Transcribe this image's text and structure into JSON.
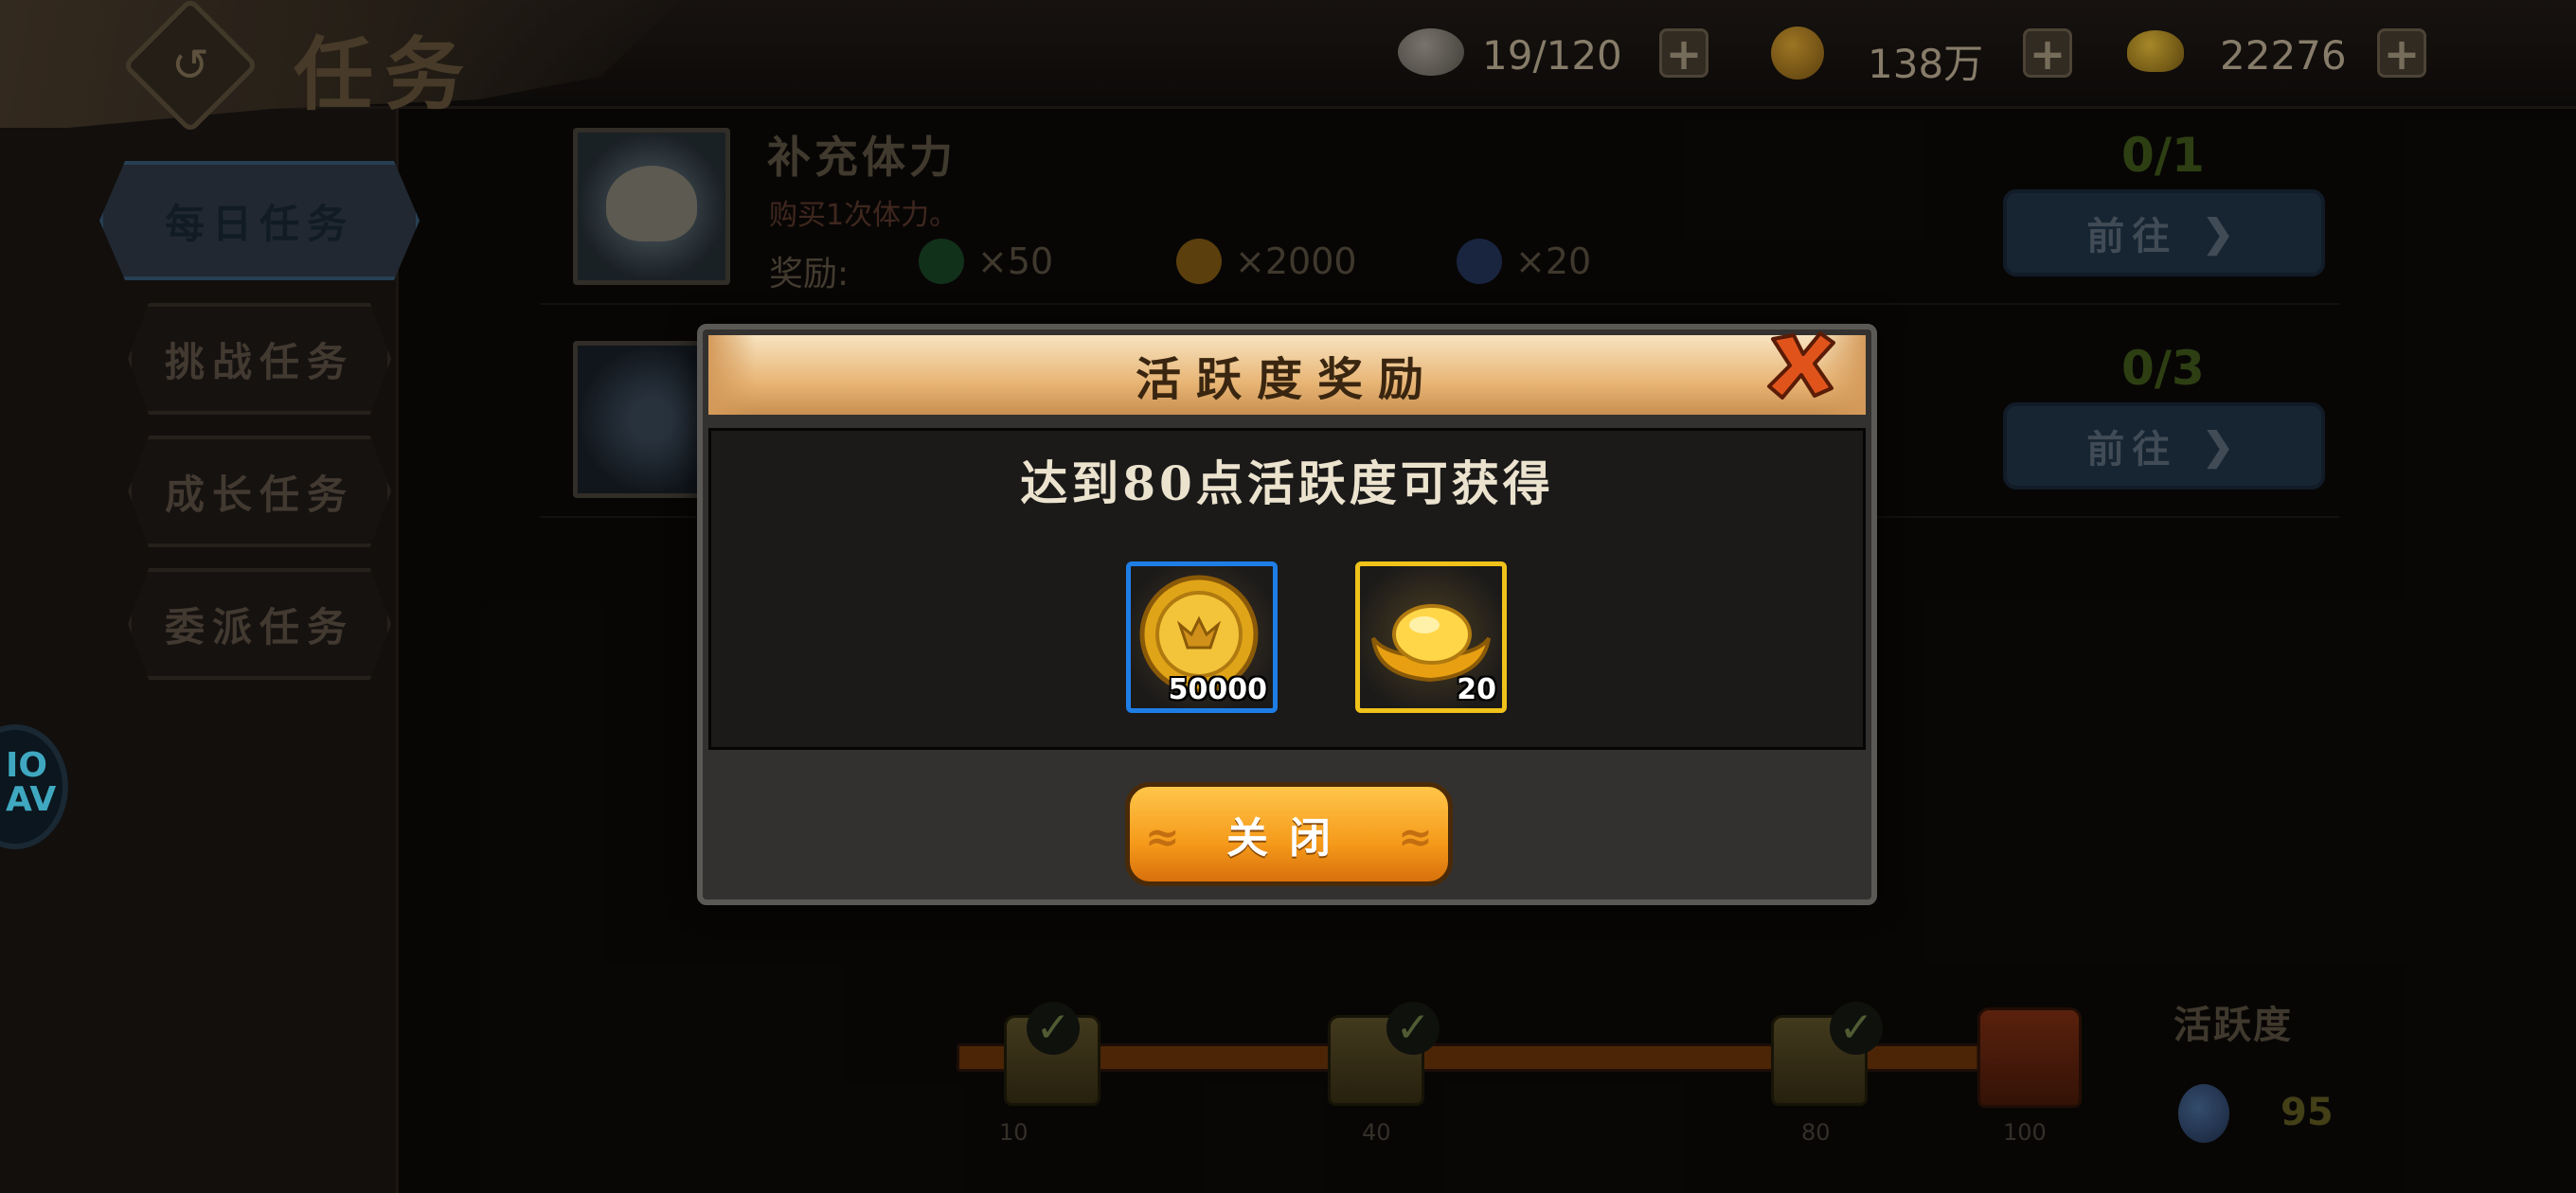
{
  "header": {
    "title": "任务",
    "back_icon": "back-arrow-icon",
    "resources": [
      {
        "name": "stamina",
        "icon": "steamed-bun-icon",
        "value": "19/120"
      },
      {
        "name": "copper",
        "icon": "copper-coin-icon",
        "value": "138万"
      },
      {
        "name": "ingot",
        "icon": "gold-ingot-icon",
        "value": "22276"
      }
    ],
    "plus_symbol": "+"
  },
  "sidebar": {
    "tabs": [
      {
        "label": "每日任务",
        "active": true
      },
      {
        "label": "挑战任务",
        "active": false
      },
      {
        "label": "成长任务",
        "active": false
      },
      {
        "label": "委派任务",
        "active": false
      }
    ]
  },
  "tasks": [
    {
      "name": "补充体力",
      "desc": "购买1次体力。",
      "reward_label": "奖励:",
      "rewards": [
        {
          "icon": "green-token-icon",
          "amount": "×50"
        },
        {
          "icon": "copper-coin-icon",
          "amount": "×2000"
        },
        {
          "icon": "activity-orb-icon",
          "amount": "×20"
        }
      ],
      "progress": "0/1",
      "button": "前往"
    },
    {
      "name": "",
      "desc": "",
      "progress": "0/3",
      "button": "前往"
    }
  ],
  "activity": {
    "title": "活跃度",
    "value": "95",
    "milestones": [
      {
        "label": "10",
        "claimed": true
      },
      {
        "label": "40",
        "claimed": true
      },
      {
        "label": "80",
        "claimed": true
      },
      {
        "label": "100",
        "claimed": false
      }
    ],
    "progress": 0.95
  },
  "side_badge": "IO\nAV",
  "modal": {
    "title": "活跃度奖励",
    "message": "达到80点活跃度可获得",
    "rewards": [
      {
        "icon": "copper-coin-icon",
        "count": "50000",
        "border": "#1e7ee6"
      },
      {
        "icon": "gold-ingot-icon",
        "count": "20",
        "border": "#f0c21a"
      }
    ],
    "close_button": "关闭",
    "close_icon": "close-x-icon"
  },
  "colors": {
    "modal_header": "#e8b575",
    "close_button": "#f59a1a",
    "coin_border": "#1e7ee6",
    "ingot_border": "#f0c21a"
  }
}
